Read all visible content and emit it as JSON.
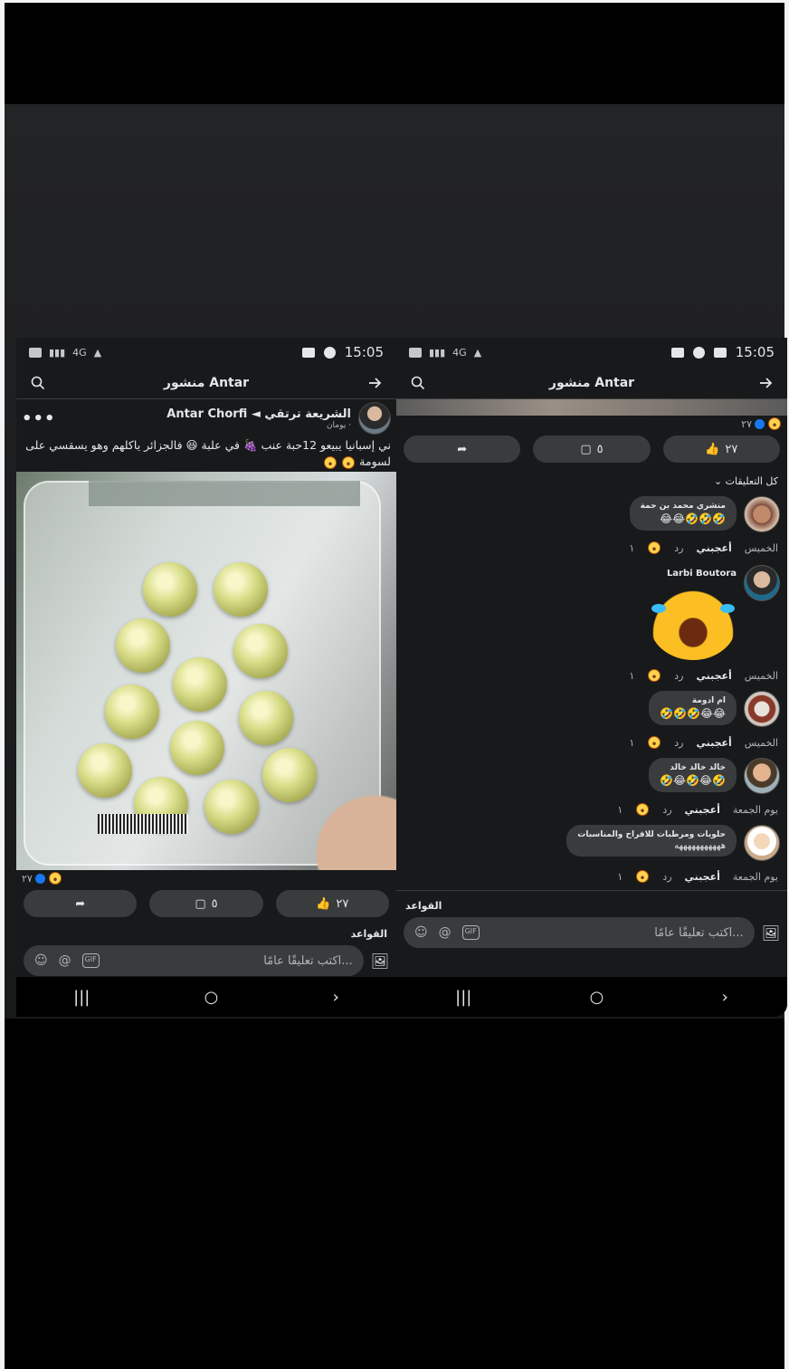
{
  "status_bar": {
    "time": "15:05",
    "signal_text": "4G"
  },
  "left_phone": {
    "header": {
      "title": "منشور Antar"
    },
    "post": {
      "author": "Antar Chorfi",
      "group": "◄ الشريعة ترتقي",
      "meta": "يومان · ",
      "text_line1": "ني إسبانيا يبيعو 12حبة عنب 🍇 في علبة 😆 فالجزائر ياكلهم وهو يسقسي على",
      "text_line2": "لسومة",
      "reactions_count": "٢٧",
      "actions": {
        "like": "٢٧",
        "comment": "٥",
        "share": ""
      }
    },
    "rules_label": "القواعد",
    "composer_placeholder": "اكتب تعليقًا عامًا..."
  },
  "right_phone": {
    "header": {
      "title": "منشور Antar"
    },
    "reactions_count": "٢٧",
    "actions": {
      "like": "٢٧",
      "comment": "٥"
    },
    "all_comments_label": "كل التعليقات",
    "comments": [
      {
        "name": "منشري محمد بن حمة",
        "text": "🤣🤣🤣😂😂",
        "day": "الخميس",
        "like": "أعجبني",
        "reply": "رد",
        "count": "١"
      },
      {
        "name": "Larbi Boutora",
        "text": "",
        "day": "الخميس",
        "like": "أعجبني",
        "reply": "رد",
        "count": "١"
      },
      {
        "name": "ام ادومة",
        "text": "😂😂🤣🤣🤣",
        "day": "الخميس",
        "like": "أعجبني",
        "reply": "رد",
        "count": "١"
      },
      {
        "name": "خالد خالد خالد",
        "text": "🤣😂🤣😂🤣",
        "day": "يوم الجمعة",
        "like": "أعجبني",
        "reply": "رد",
        "count": "١"
      },
      {
        "name": "حلويات ومرطبات للافراح والمناسبات",
        "text": "هههههههههههه",
        "day": "يوم الجمعة",
        "like": "أعجبني",
        "reply": "رد",
        "count": "١"
      }
    ],
    "rules_label": "القواعد",
    "composer_placeholder": "اكتب تعليقًا عامًا..."
  },
  "colors": {
    "background": "#18191a",
    "surface": "#3a3b3c",
    "text": "#e4e6eb",
    "muted": "#b0b3b8",
    "accent": "#1877f2"
  },
  "icons": [
    "search-icon",
    "arrow-right-icon",
    "more-dots-icon",
    "like-icon",
    "comment-icon",
    "share-icon",
    "emoji-icon",
    "at-icon",
    "gif-icon",
    "photo-icon",
    "recent-apps-icon",
    "home-icon",
    "back-icon"
  ]
}
